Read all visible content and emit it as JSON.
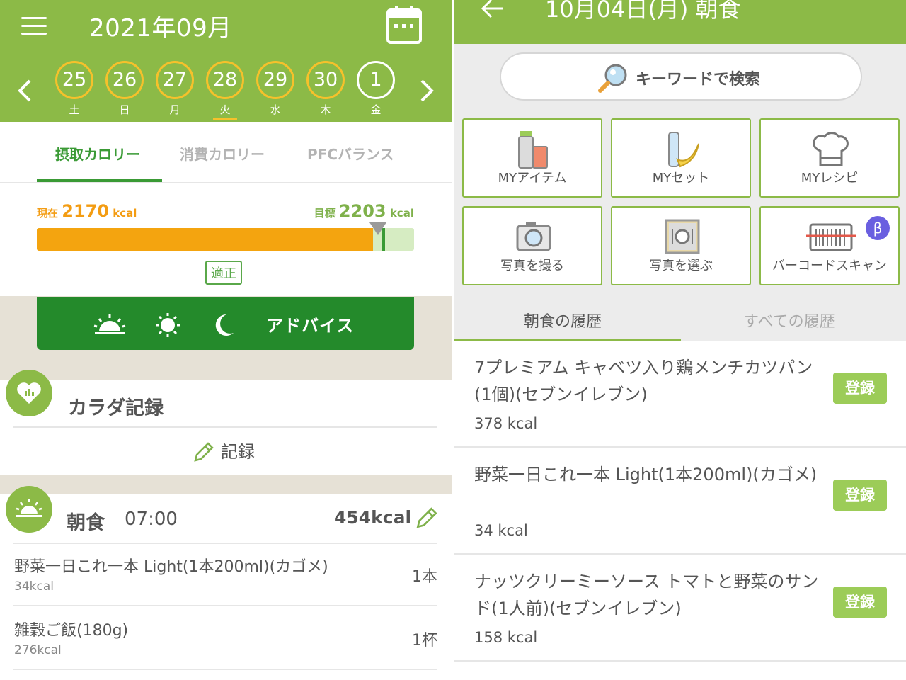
{
  "left": {
    "header": {
      "month_title": "2021年09月",
      "days": [
        {
          "num": "25",
          "wd": "土"
        },
        {
          "num": "26",
          "wd": "日"
        },
        {
          "num": "27",
          "wd": "月"
        },
        {
          "num": "28",
          "wd": "火"
        },
        {
          "num": "29",
          "wd": "水"
        },
        {
          "num": "30",
          "wd": "木"
        },
        {
          "num": "1",
          "wd": "金"
        }
      ]
    },
    "tabs": [
      "摂取カロリー",
      "消費カロリー",
      "PFCバランス"
    ],
    "calorie": {
      "current_label": "現在",
      "current_value": "2170",
      "goal_label": "目標",
      "goal_value": "2203",
      "unit": "kcal",
      "progress_fraction": 0.985,
      "status": "適正"
    },
    "advice_label": "アドバイス",
    "body_record": {
      "title": "カラダ記録",
      "record_button": "記録"
    },
    "breakfast": {
      "name": "朝食",
      "time": "07:00",
      "kcal": "454kcal",
      "items": [
        {
          "name": "野菜一日これ一本 Light(1本200ml)(カゴメ)",
          "kcal": "34kcal",
          "qty": "1本"
        },
        {
          "name": "雑穀ご飯(180g)",
          "kcal": "276kcal",
          "qty": "1杯"
        }
      ]
    }
  },
  "right": {
    "header_title": "10月04日(月) 朝食",
    "search_label": "キーワードで検索",
    "grid": [
      "MYアイテム",
      "MYセット",
      "MYレシピ",
      "写真を撮る",
      "写真を選ぶ",
      "バーコードスキャン"
    ],
    "beta_label": "β",
    "history_tabs": [
      "朝食の履歴",
      "すべての履歴"
    ],
    "register_label": "登録",
    "history": [
      {
        "name": "7プレミアム キャベツ入り鶏メンチカツパン(1個)(セブンイレブン)",
        "kcal": "378 kcal"
      },
      {
        "name": "野菜一日これ一本 Light(1本200ml)(カゴメ)",
        "kcal": "34 kcal"
      },
      {
        "name": "ナッツクリーミーソース トマトと野菜のサンド(1人前)(セブンイレブン)",
        "kcal": "158 kcal"
      }
    ]
  },
  "colors": {
    "header_green": "#8cba47",
    "dark_green": "#248a2b",
    "orange": "#f4a40f",
    "yellow_ring": "#f6c12b",
    "beta_purple": "#6a5fe0"
  }
}
